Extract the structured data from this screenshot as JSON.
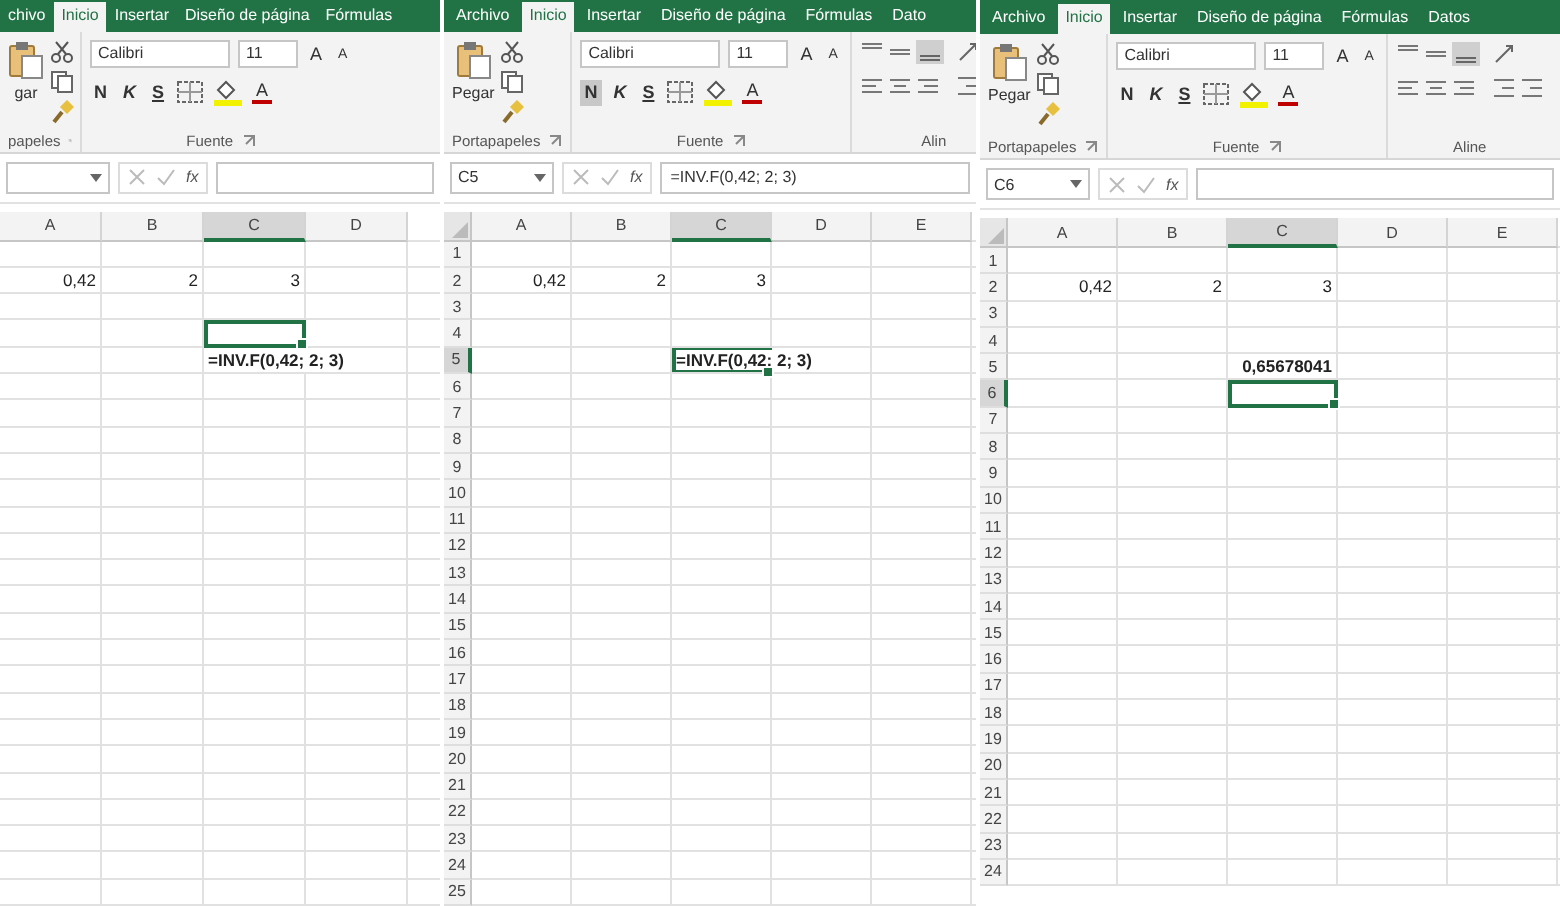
{
  "panels": [
    {
      "tabs": [
        {
          "label": "chivo",
          "selected": false
        },
        {
          "label": "Inicio",
          "selected": true
        },
        {
          "label": "Insertar",
          "selected": false
        },
        {
          "label": "Diseño de página",
          "selected": false
        },
        {
          "label": "Fórmulas",
          "selected": false
        }
      ],
      "ribbon": {
        "paste_label": "gar",
        "font_name": "Calibri",
        "font_size": "11",
        "grow_label": "A",
        "shrink_label": "A",
        "style_buttons": [
          {
            "label": "N",
            "selected": false
          },
          {
            "label": "K",
            "selected": false
          },
          {
            "label": "S",
            "selected": false
          }
        ],
        "color_label": "A",
        "groups": [
          "papeles",
          "Fuente"
        ]
      },
      "function_label": "fx",
      "columns": [
        {
          "label": "A",
          "selected": false
        },
        {
          "label": "B",
          "selected": false
        },
        {
          "label": "C",
          "selected": true
        },
        {
          "label": "D",
          "selected": false
        }
      ],
      "rows": [
        {},
        {
          "cells": [
            {
              "text": "0,42",
              "kind": "number",
              "bold": false,
              "selected": false
            },
            {
              "text": "2",
              "kind": "number",
              "bold": false,
              "selected": false
            },
            {
              "text": "3",
              "kind": "number",
              "bold": false,
              "selected": false
            },
            {
              "selected": false
            }
          ]
        },
        {},
        {
          "cells": [
            {
              "selected": false
            },
            {
              "selected": false
            },
            {
              "selected": true
            },
            {
              "selected": false
            }
          ]
        },
        {
          "cells": [
            {
              "selected": false
            },
            {
              "selected": false
            },
            {
              "text": "=INV.F(0,42; 2; 3)",
              "kind": "text",
              "bold": true,
              "selected": false
            },
            {}
          ]
        },
        {},
        {},
        {},
        {},
        {},
        {},
        {},
        {},
        {},
        {},
        {},
        {},
        {},
        {},
        {},
        {},
        {},
        {},
        {},
        {}
      ]
    },
    {
      "tabs": [
        {
          "label": "Archivo",
          "selected": false
        },
        {
          "label": "Inicio",
          "selected": true
        },
        {
          "label": "Insertar",
          "selected": false
        },
        {
          "label": "Diseño de página",
          "selected": false
        },
        {
          "label": "Fórmulas",
          "selected": false
        },
        {
          "label": "Dato",
          "selected": false
        }
      ],
      "ribbon": {
        "paste_label": "Pegar",
        "font_name": "Calibri",
        "font_size": "11",
        "grow_label": "A",
        "shrink_label": "A",
        "style_buttons": [
          {
            "label": "N",
            "selected": true
          },
          {
            "label": "K",
            "selected": false
          },
          {
            "label": "S",
            "selected": false
          }
        ],
        "color_label": "A",
        "groups": [
          "Portapapeles",
          "Fuente",
          "Alin"
        ]
      },
      "name_box": "C5",
      "function_label": "fx",
      "formula": "=INV.F(0,42; 2; 3)",
      "columns": [
        {
          "label": "A",
          "selected": false
        },
        {
          "label": "B",
          "selected": false
        },
        {
          "label": "C",
          "selected": true
        },
        {
          "label": "D",
          "selected": false
        },
        {
          "label": "E",
          "selected": false
        }
      ],
      "rows": [
        {
          "number": "1",
          "selected": false
        },
        {
          "number": "2",
          "selected": false,
          "cells": [
            {
              "text": "0,42",
              "kind": "number",
              "bold": false,
              "selected": false
            },
            {
              "text": "2",
              "kind": "number",
              "bold": false,
              "selected": false
            },
            {
              "text": "3",
              "kind": "number",
              "bold": false,
              "selected": false
            },
            {
              "selected": false
            },
            {
              "selected": false
            }
          ]
        },
        {
          "number": "3",
          "selected": false
        },
        {
          "number": "4",
          "selected": false
        },
        {
          "number": "5",
          "selected": true,
          "cells": [
            {
              "selected": false
            },
            {
              "selected": false
            },
            {
              "text": "=INV.F(0,42; 2; 3)",
              "kind": "text",
              "bold": true,
              "selected": true
            },
            {},
            {
              "selected": false
            }
          ]
        },
        {
          "number": "6",
          "selected": false
        },
        {
          "number": "7",
          "selected": false
        },
        {
          "number": "8",
          "selected": false
        },
        {
          "number": "9",
          "selected": false
        },
        {
          "number": "10",
          "selected": false
        },
        {
          "number": "11",
          "selected": false
        },
        {
          "number": "12",
          "selected": false
        },
        {
          "number": "13",
          "selected": false
        },
        {
          "number": "14",
          "selected": false
        },
        {
          "number": "15",
          "selected": false
        },
        {
          "number": "16",
          "selected": false
        },
        {
          "number": "17",
          "selected": false
        },
        {
          "number": "18",
          "selected": false
        },
        {
          "number": "19",
          "selected": false
        },
        {
          "number": "20",
          "selected": false
        },
        {
          "number": "21",
          "selected": false
        },
        {
          "number": "22",
          "selected": false
        },
        {
          "number": "23",
          "selected": false
        },
        {
          "number": "24",
          "selected": false
        },
        {
          "number": "25",
          "selected": false
        }
      ]
    },
    {
      "tabs": [
        {
          "label": "Archivo",
          "selected": false
        },
        {
          "label": "Inicio",
          "selected": true
        },
        {
          "label": "Insertar",
          "selected": false
        },
        {
          "label": "Diseño de página",
          "selected": false
        },
        {
          "label": "Fórmulas",
          "selected": false
        },
        {
          "label": "Datos",
          "selected": false
        }
      ],
      "ribbon": {
        "paste_label": "Pegar",
        "font_name": "Calibri",
        "font_size": "11",
        "grow_label": "A",
        "shrink_label": "A",
        "style_buttons": [
          {
            "label": "N",
            "selected": false
          },
          {
            "label": "K",
            "selected": false
          },
          {
            "label": "S",
            "selected": false
          }
        ],
        "color_label": "A",
        "groups": [
          "Portapapeles",
          "Fuente",
          "Aline"
        ]
      },
      "name_box": "C6",
      "function_label": "fx",
      "columns": [
        {
          "label": "A",
          "selected": false
        },
        {
          "label": "B",
          "selected": false
        },
        {
          "label": "C",
          "selected": true
        },
        {
          "label": "D",
          "selected": false
        },
        {
          "label": "E",
          "selected": false
        }
      ],
      "rows": [
        {
          "number": "1",
          "selected": false
        },
        {
          "number": "2",
          "selected": false,
          "cells": [
            {
              "text": "0,42",
              "kind": "number",
              "bold": false,
              "selected": false
            },
            {
              "text": "2",
              "kind": "number",
              "bold": false,
              "selected": false
            },
            {
              "text": "3",
              "kind": "number",
              "bold": false,
              "selected": false
            },
            {
              "selected": false
            },
            {
              "selected": false
            }
          ]
        },
        {
          "number": "3",
          "selected": false
        },
        {
          "number": "4",
          "selected": false
        },
        {
          "number": "5",
          "selected": false,
          "cells": [
            {
              "selected": false
            },
            {
              "selected": false
            },
            {
              "text": "0,65678041",
              "kind": "number",
              "bold": true,
              "selected": false
            },
            {
              "selected": false
            },
            {
              "selected": false
            }
          ]
        },
        {
          "number": "6",
          "selected": true,
          "cells": [
            {
              "selected": false
            },
            {
              "selected": false
            },
            {
              "selected": true
            },
            {
              "selected": false
            },
            {
              "selected": false
            }
          ]
        },
        {
          "number": "7",
          "selected": false
        },
        {
          "number": "8",
          "selected": false
        },
        {
          "number": "9",
          "selected": false
        },
        {
          "number": "10",
          "selected": false
        },
        {
          "number": "11",
          "selected": false
        },
        {
          "number": "12",
          "selected": false
        },
        {
          "number": "13",
          "selected": false
        },
        {
          "number": "14",
          "selected": false
        },
        {
          "number": "15",
          "selected": false
        },
        {
          "number": "16",
          "selected": false
        },
        {
          "number": "17",
          "selected": false
        },
        {
          "number": "18",
          "selected": false
        },
        {
          "number": "19",
          "selected": false
        },
        {
          "number": "20",
          "selected": false
        },
        {
          "number": "21",
          "selected": false
        },
        {
          "number": "22",
          "selected": false
        },
        {
          "number": "23",
          "selected": false
        },
        {
          "number": "24",
          "selected": false
        }
      ]
    }
  ]
}
